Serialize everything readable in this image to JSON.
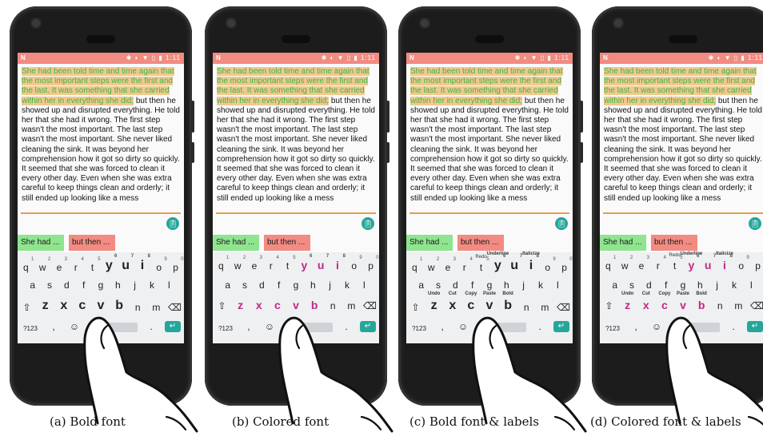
{
  "status_bar": {
    "left": "N",
    "right": "✱ ◐ ▼ ▯ ▮ 1:11"
  },
  "text": {
    "highlighted": "She had been told time and time again that the most important steps were the first and the last. It was something that she carried within her in everything she did;",
    "rest": " but then he showed up and disrupted everything. He told her that she had it wrong. The first step wasn't the most important. The last step wasn't the most important. She never liked cleaning the sink. It was beyond her comprehension how it got so dirty so quickly. It seemed that she was forced to clean it every other day. Even when she was extra careful to keep things clean and orderly; it still ended up looking like a mess"
  },
  "chips": {
    "first": "She had ...",
    "second": "but then ..."
  },
  "clipboard_icon": "clipboard-icon",
  "keyboard": {
    "row1": [
      "q",
      "w",
      "e",
      "r",
      "t",
      "y",
      "u",
      "i",
      "o",
      "p"
    ],
    "row1_nums": [
      "1",
      "2",
      "3",
      "4",
      "5",
      "6",
      "7",
      "8",
      "9",
      "0"
    ],
    "row2": [
      "a",
      "s",
      "d",
      "f",
      "g",
      "h",
      "j",
      "k",
      "l"
    ],
    "row3": [
      "z",
      "x",
      "c",
      "v",
      "b",
      "n",
      "m"
    ],
    "shift": "⇧",
    "backspace": "⌫",
    "sym": "?123",
    "comma": ",",
    "emoji": "☺",
    "period": ".",
    "enter": "↵",
    "labels_row1": {
      "t": "Redo",
      "y": "Underline",
      "i": "Italicize"
    },
    "labels_row3": {
      "z": "Undo",
      "x": "Cut",
      "c": "Copy",
      "v": "Paste",
      "b": "Bold"
    }
  },
  "captions": [
    "(a) Bold font",
    "(b) Colored font",
    "(c) Bold font & labels",
    "(d) Colored font & labels"
  ],
  "colors": {
    "statusbar": "#f28b82",
    "highlight": "#f3c88c",
    "highlight_text": "#3bb54a",
    "accent": "#26a69a",
    "emphasis": "#c2268a"
  }
}
